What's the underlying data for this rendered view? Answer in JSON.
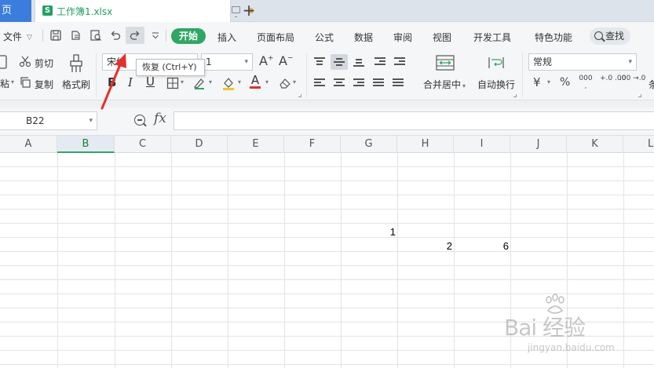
{
  "tabbar": {
    "home_label": "页",
    "file_icon_letter": "S",
    "file_name": "工作簿1.xlsx",
    "new_tab_symbol": "+"
  },
  "menubar": {
    "file_label": "文件",
    "start_label": "开始",
    "items": [
      "插入",
      "页面布局",
      "公式",
      "数据",
      "审阅",
      "视图",
      "开发工具",
      "特色功能"
    ],
    "search_label": "查找",
    "colors": {
      "start_bg": "#2fa764",
      "home_tab_bg": "#3b7ddd"
    }
  },
  "ribbon": {
    "cut_label": "剪切",
    "paste_label": "粘",
    "copy_label": "复制",
    "format_painter_label": "格式刷",
    "font_name": "宋体",
    "font_size": "1",
    "merge_label": "合并居中",
    "wrap_label": "自动换行",
    "number_format": "常规",
    "currency_symbol": "¥",
    "percent_symbol": "%",
    "thousands_label": "000",
    "dec_increase_label": "+.0 .00",
    "dec_decrease_label": ".00 →.0",
    "tooltip": "恢复 (Ctrl+Y)",
    "colors": {
      "font_color": "#e03030",
      "fill_color": "#f5c518"
    }
  },
  "formula_bar": {
    "name_box": "B22",
    "fx_label": "fx",
    "formula_value": ""
  },
  "grid": {
    "columns": [
      "A",
      "B",
      "C",
      "D",
      "E",
      "F",
      "G",
      "H",
      "I",
      "J",
      "K",
      "L"
    ],
    "active_column": "B",
    "cells": [
      {
        "col": "G",
        "row_index": 5,
        "value": "1"
      },
      {
        "col": "H",
        "row_index": 6,
        "value": "2"
      },
      {
        "col": "I",
        "row_index": 6,
        "value": "6"
      }
    ]
  },
  "watermark": {
    "logo": "Bai 经验",
    "url": "jingyan.baidu.com"
  }
}
